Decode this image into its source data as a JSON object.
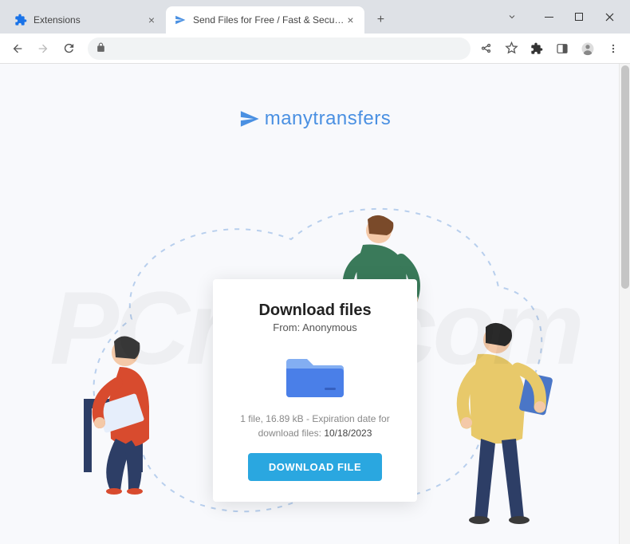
{
  "window": {
    "tabs": [
      {
        "title": "Extensions",
        "active": false
      },
      {
        "title": "Send Files for Free / Fast & Secu…",
        "active": true
      }
    ]
  },
  "brand": {
    "name": "manytransfers",
    "color": "#4a90e2"
  },
  "card": {
    "heading": "Download files",
    "from_label": "From: ",
    "from_value": "Anonymous",
    "file_count": "1 file",
    "file_size": "16.89 kB",
    "expiration_prefix": " - Expiration date for download files: ",
    "expiration_date": "10/18/2023",
    "button_label": "DOWNLOAD FILE"
  },
  "watermark_text": "PCrisk.com"
}
